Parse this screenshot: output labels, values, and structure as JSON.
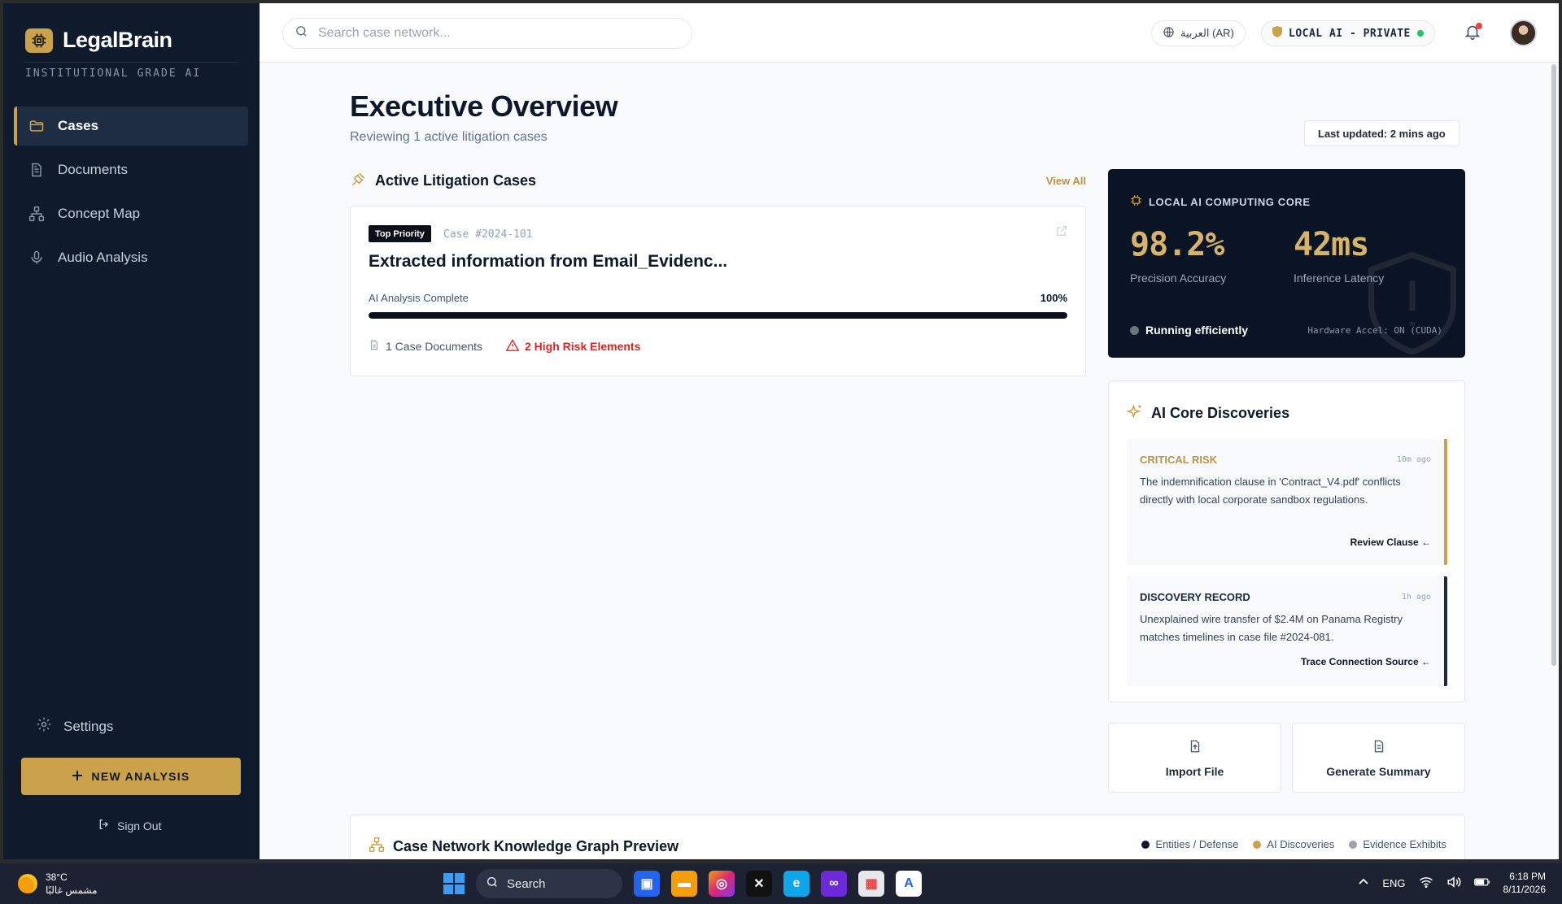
{
  "sidebar": {
    "brand_name": "LegalBrain",
    "brand_tagline": "INSTITUTIONAL GRADE AI",
    "items": [
      {
        "label": "Cases",
        "icon": "folder-icon",
        "active": true
      },
      {
        "label": "Documents",
        "icon": "document-icon",
        "active": false
      },
      {
        "label": "Concept Map",
        "icon": "network-icon",
        "active": false
      },
      {
        "label": "Audio Analysis",
        "icon": "microphone-icon",
        "active": false
      }
    ],
    "settings_label": "Settings",
    "new_analysis_label": "NEW ANALYSIS",
    "sign_out_label": "Sign Out"
  },
  "topbar": {
    "search_placeholder": "Search case network...",
    "language_label": "العربية (AR)",
    "ai_mode_label": "LOCAL AI - PRIVATE"
  },
  "header": {
    "title": "Executive Overview",
    "subtitle": "Reviewing 1 active litigation cases",
    "last_updated": "Last updated: 2 mins ago"
  },
  "cases_section": {
    "title": "Active Litigation Cases",
    "view_all": "View All",
    "case": {
      "priority_badge": "Top Priority",
      "case_id": "Case #2024-101",
      "title": "Extracted information from Email_Evidenc...",
      "progress_label": "AI Analysis Complete",
      "progress_text": "100%",
      "progress_fraction": 1.0,
      "documents": "1 Case Documents",
      "risk": "2 High Risk Elements"
    }
  },
  "ai_core": {
    "title": "LOCAL AI COMPUTING CORE",
    "metric1_value": "98.2%",
    "metric1_label": "Precision Accuracy",
    "metric2_value": "42ms",
    "metric2_label": "Inference Latency",
    "status": "Running efficiently",
    "hardware": "Hardware Accel: ON (CUDA)"
  },
  "discoveries": {
    "title": "AI Core Discoveries",
    "items": [
      {
        "type": "CRITICAL RISK",
        "time": "10m ago",
        "text": "The indemnification clause in 'Contract_V4.pdf' conflicts directly with local corporate sandbox regulations.",
        "link": "Review Clause ←",
        "accent": "#c9a24b"
      },
      {
        "type": "DISCOVERY RECORD",
        "time": "1h ago",
        "text": "Unexplained wire transfer of $2.4M on Panama Registry matches timelines in case file #2024-081.",
        "link": "Trace Connection Source ←",
        "accent": "#1e293b"
      }
    ]
  },
  "actions": {
    "import": "Import File",
    "summary": "Generate Summary"
  },
  "graph": {
    "title": "Case Network Knowledge Graph Preview",
    "legend": [
      {
        "label": "Entities / Defense",
        "color": "#0f172a"
      },
      {
        "label": "AI Discoveries",
        "color": "#c9a24b"
      },
      {
        "label": "Evidence Exhibits",
        "color": "#9ca3af"
      }
    ]
  },
  "taskbar": {
    "temperature": "38°C",
    "weather_desc": "مشمس غالبًا",
    "search_label": "Search",
    "language": "ENG",
    "time": "6:18 PM",
    "date": "8/11/2026"
  },
  "colors": {
    "accent_gold": "#c9a24b",
    "sidebar_bg": "#0f1b2d",
    "risk_red": "#dc2626",
    "status_green": "#22c55e"
  }
}
